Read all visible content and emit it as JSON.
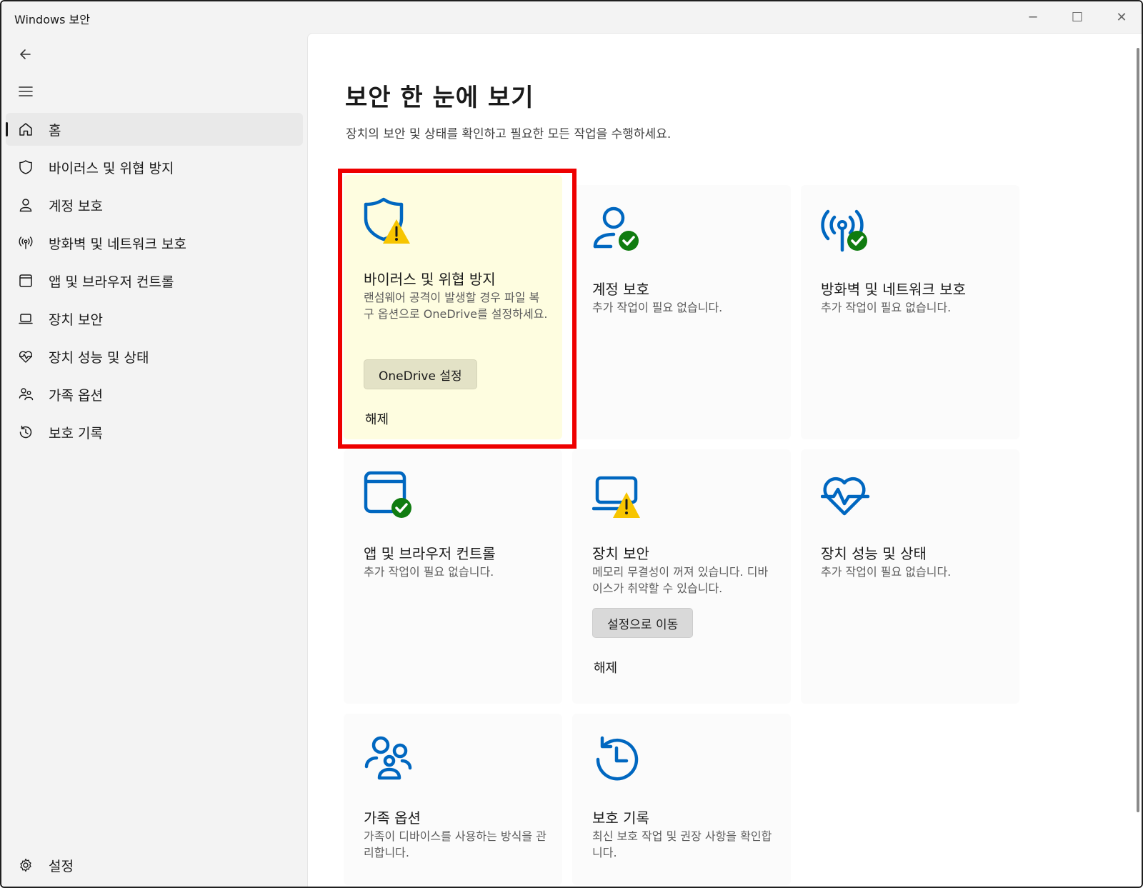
{
  "window": {
    "title": "Windows 보안",
    "controls": {
      "minimize": "─",
      "maximize": "☐",
      "close": "✕"
    }
  },
  "sidebar": {
    "items": [
      {
        "label": "홈",
        "icon": "home-icon",
        "active": true
      },
      {
        "label": "바이러스 및 위협 방지",
        "icon": "shield-icon"
      },
      {
        "label": "계정 보호",
        "icon": "person-icon"
      },
      {
        "label": "방화벽 및 네트워크 보호",
        "icon": "wireless-icon"
      },
      {
        "label": "앱 및 브라우저 컨트롤",
        "icon": "app-window-icon"
      },
      {
        "label": "장치 보안",
        "icon": "laptop-icon"
      },
      {
        "label": "장치 성능 및 상태",
        "icon": "heart-pulse-icon"
      },
      {
        "label": "가족 옵션",
        "icon": "family-icon"
      },
      {
        "label": "보호 기록",
        "icon": "history-icon"
      }
    ],
    "settings_label": "설정"
  },
  "main": {
    "title": "보안 한 눈에 보기",
    "subtitle": "장치의 보안 및 상태를 확인하고 필요한 모든 작업을 수행하세요.",
    "cards": [
      {
        "title": "바이러스 및 위협 방지",
        "description": "랜섬웨어 공격이 발생할 경우 파일 복구 옵션으로 OneDrive를 설정하세요.",
        "button": "OneDrive 설정",
        "dismiss": "해제",
        "status": "warning"
      },
      {
        "title": "계정 보호",
        "description": "추가 작업이 필요 없습니다.",
        "status": "ok"
      },
      {
        "title": "방화벽 및 네트워크 보호",
        "description": "추가 작업이 필요 없습니다.",
        "status": "ok"
      },
      {
        "title": "앱 및 브라우저 컨트롤",
        "description": "추가 작업이 필요 없습니다.",
        "status": "ok"
      },
      {
        "title": "장치 보안",
        "description": "메모리 무결성이 꺼져 있습니다. 디바이스가 취약할 수 있습니다.",
        "button": "설정으로 이동",
        "dismiss": "해제",
        "status": "warning"
      },
      {
        "title": "장치 성능 및 상태",
        "description": "추가 작업이 필요 없습니다.",
        "status": "info"
      },
      {
        "title": "가족 옵션",
        "description": "가족이 디바이스를 사용하는 방식을 관리합니다.",
        "status": "info"
      },
      {
        "title": "보호 기록",
        "description": "최신 보호 작업 및 권장 사항을 확인합니다.",
        "status": "info"
      }
    ]
  },
  "colors": {
    "accent": "#0067c0",
    "ok": "#107c10",
    "warning": "#f7c500",
    "warning_card_bg": "#fefde0",
    "highlight": "#ee0000"
  }
}
